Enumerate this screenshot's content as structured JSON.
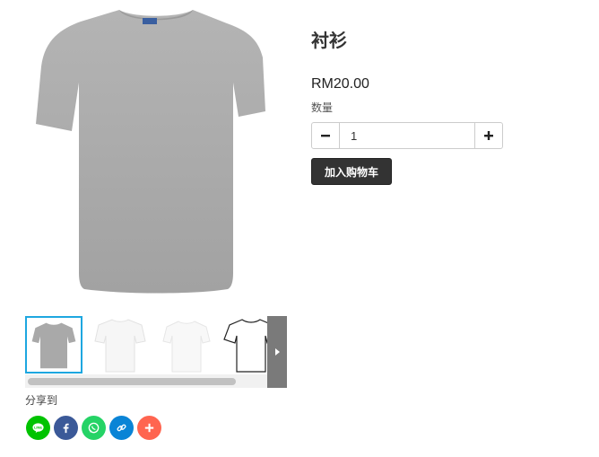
{
  "product": {
    "title": "衬衫",
    "price": "RM20.00",
    "quantity_label": "数量",
    "quantity_value": "1",
    "add_to_cart_label": "加入购物车"
  },
  "gallery": {
    "main_image": "grey-tshirt-image",
    "thumbnails": [
      {
        "name": "grey-tshirt",
        "selected": true
      },
      {
        "name": "white-tshirt-front",
        "selected": false
      },
      {
        "name": "white-tshirt-plain",
        "selected": false
      },
      {
        "name": "white-tshirt-outline",
        "selected": false
      }
    ]
  },
  "share": {
    "label": "分享到",
    "buttons": [
      {
        "name": "line",
        "color": "#00c300"
      },
      {
        "name": "facebook",
        "color": "#3b5998"
      },
      {
        "name": "whatsapp",
        "color": "#25d366"
      },
      {
        "name": "copy-link",
        "color": "#0a84d6"
      },
      {
        "name": "more",
        "color": "#ff6550"
      }
    ]
  },
  "colors": {
    "accent_border": "#1ea7e0",
    "button_dark": "#333333"
  }
}
